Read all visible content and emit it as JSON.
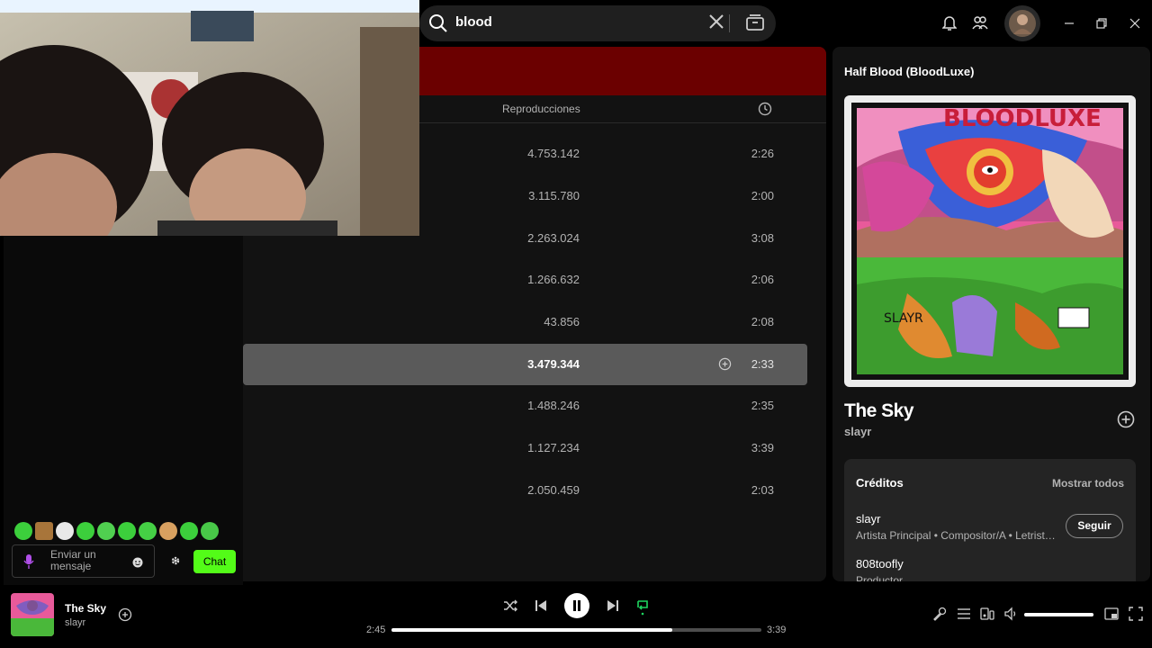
{
  "search": {
    "query": "blood"
  },
  "table": {
    "plays_header": "Reproducciones",
    "rows": [
      {
        "plays": "4.753.142",
        "duration": "2:26"
      },
      {
        "plays": "3.115.780",
        "duration": "2:00"
      },
      {
        "plays": "2.263.024",
        "duration": "3:08"
      },
      {
        "plays": "1.266.632",
        "duration": "2:06"
      },
      {
        "plays": "43.856",
        "duration": "2:08"
      },
      {
        "plays": "3.479.344",
        "duration": "2:33"
      },
      {
        "plays": "1.488.246",
        "duration": "2:35"
      },
      {
        "plays": "1.127.234",
        "duration": "3:39"
      },
      {
        "plays": "2.050.459",
        "duration": "2:03"
      }
    ]
  },
  "now_playing_panel": {
    "album_title": "Half Blood (BloodLuxe)",
    "track": "The Sky",
    "artist": "slayr",
    "credits_title": "Créditos",
    "credits_show_all": "Mostrar todos",
    "credits": [
      {
        "name": "slayr",
        "role": "Artista Principal • Compositor/A • Letrist…"
      },
      {
        "name": "808toofly",
        "role": "Productor"
      }
    ],
    "follow_label": "Seguir"
  },
  "chat": {
    "placeholder": "Enviar un mensaje",
    "button_label": "Chat",
    "accent": "#53fc18"
  },
  "player": {
    "track": "The Sky",
    "artist": "slayr",
    "elapsed": "2:45",
    "total": "3:39",
    "progress_fraction": 0.76,
    "volume_fraction": 1.0
  },
  "colors": {
    "banner": "#6b0000",
    "spotify_green": "#1ed760"
  }
}
